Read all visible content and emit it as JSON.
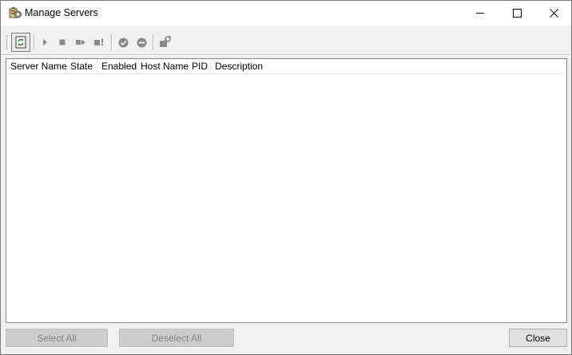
{
  "window": {
    "title": "Manage Servers",
    "icon": "manage-servers-icon",
    "controls": {
      "minimize": "minimize-icon",
      "maximize": "maximize-icon",
      "close": "close-icon"
    }
  },
  "toolbar": {
    "buttons": [
      {
        "name": "refresh",
        "icon": "refresh-icon",
        "enabled": true
      },
      {
        "name": "start",
        "icon": "play-icon",
        "enabled": false
      },
      {
        "name": "stop",
        "icon": "stop-icon",
        "enabled": false
      },
      {
        "name": "restart",
        "icon": "restart-icon",
        "enabled": false
      },
      {
        "name": "kill",
        "icon": "kill-icon",
        "enabled": false
      },
      {
        "name": "enable",
        "icon": "check-circle-icon",
        "enabled": false
      },
      {
        "name": "disable",
        "icon": "minus-circle-icon",
        "enabled": false
      },
      {
        "name": "properties",
        "icon": "tools-icon",
        "enabled": false
      }
    ]
  },
  "table": {
    "columns": [
      "Server Name",
      "State",
      "Enabled",
      "Host Name",
      "PID",
      "Description"
    ],
    "rows": []
  },
  "footer": {
    "select_all": "Select All",
    "deselect_all": "Deselect All",
    "close": "Close"
  },
  "colors": {
    "disabled_text": "#838383",
    "refresh_green": "#2e8b2e",
    "toolbar_gray": "#8a8a8a"
  }
}
